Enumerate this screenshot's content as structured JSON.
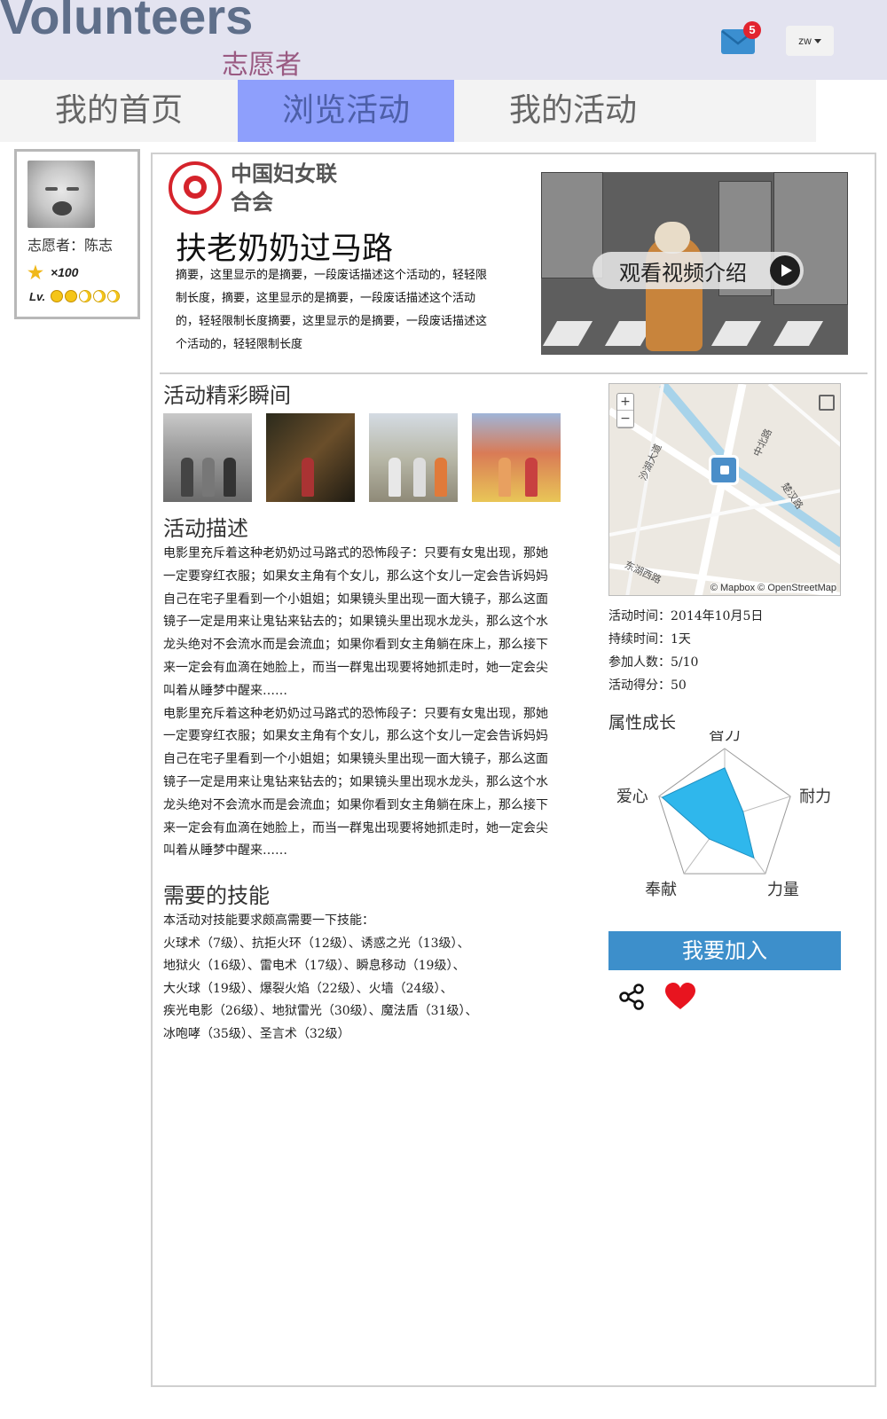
{
  "header": {
    "logo_en": "Volunteers",
    "logo_cn": "志愿者",
    "mail_badge": "5",
    "user_menu": "zw"
  },
  "nav": {
    "tabs": [
      {
        "label": "我的首页"
      },
      {
        "label": "浏览活动"
      },
      {
        "label": "我的活动"
      }
    ],
    "active_tab": "浏览活动"
  },
  "profile": {
    "name": "志愿者：陈志",
    "points": "×100",
    "level_label": "Lv."
  },
  "activity": {
    "org_name": "中国妇女联合会",
    "title": "扶老奶奶过马路",
    "summary": "摘要，这里显示的是摘要，一段废话描述这个活动的，轻轻限制长度，摘要，这里显示的是摘要，一段废话描述这个活动的，轻轻限制长度摘要，这里显示的是摘要，一段废话描述这个活动的，轻轻限制长度",
    "video_button": "观看视频介绍",
    "highlights_title": "活动精彩瞬间",
    "description_title": "活动描述",
    "description": [
      "电影里充斥着这种老奶奶过马路式的恐怖段子：只要有女鬼出现，那她一定要穿红衣服；如果女主角有个女儿，那么这个女儿一定会告诉妈妈自己在宅子里看到一个小姐姐；如果镜头里出现一面大镜子，那么这面镜子一定是用来让鬼钻来钻去的；如果镜头里出现水龙头，那么这个水龙头绝对不会流水而是会流血；如果你看到女主角躺在床上，那么接下来一定会有血滴在她脸上，而当一群鬼出现要将她抓走时，她一定会尖叫着从睡梦中醒来……",
      "电影里充斥着这种老奶奶过马路式的恐怖段子：只要有女鬼出现，那她一定要穿红衣服；如果女主角有个女儿，那么这个女儿一定会告诉妈妈自己在宅子里看到一个小姐姐；如果镜头里出现一面大镜子，那么这面镜子一定是用来让鬼钻来钻去的；如果镜头里出现水龙头，那么这个水龙头绝对不会流水而是会流血；如果你看到女主角躺在床上，那么接下来一定会有血滴在她脸上，而当一群鬼出现要将她抓走时，她一定会尖叫着从睡梦中醒来……"
    ],
    "skills_title": "需要的技能",
    "skills_intro": "本活动对技能要求颇高需要一下技能：",
    "skills_lines": [
      "火球术（7级）、抗拒火环（12级）、诱惑之光（13级）、",
      "地狱火（16级）、雷电术（17级）、瞬息移动（19级）、",
      "大火球（19级）、爆裂火焰（22级）、火墙（24级）、",
      "疾光电影（26级）、地狱雷光（30级）、魔法盾（31级）、",
      "冰咆哮（35级）、圣言术（32级）"
    ]
  },
  "map": {
    "labels": [
      "沙湖大道",
      "中北路",
      "楚汉路",
      "东湖西路"
    ],
    "attribution": "© Mapbox © OpenStreetMap",
    "zoom_in": "+",
    "zoom_out": "−"
  },
  "stats": {
    "time": "活动时间：2014年10月5日",
    "duration": "持续时间：1天",
    "participants": "参加人数：5/10",
    "score": "活动得分：50"
  },
  "radar": {
    "title": "属性成长",
    "axes": [
      "智力",
      "耐力",
      "力量",
      "奉献",
      "爱心"
    ],
    "values": [
      0.72,
      0.28,
      0.72,
      0.38,
      0.95
    ],
    "fill_color": "#2fb7ec"
  },
  "actions": {
    "join_label": "我要加入",
    "share_icon": "share-icon",
    "like_icon": "heart-icon",
    "like_color": "#e8141f"
  },
  "colors": {
    "nav_active": "#8e9ffc",
    "header_bg": "#e3e3f0",
    "join_btn": "#3d8fcb"
  }
}
